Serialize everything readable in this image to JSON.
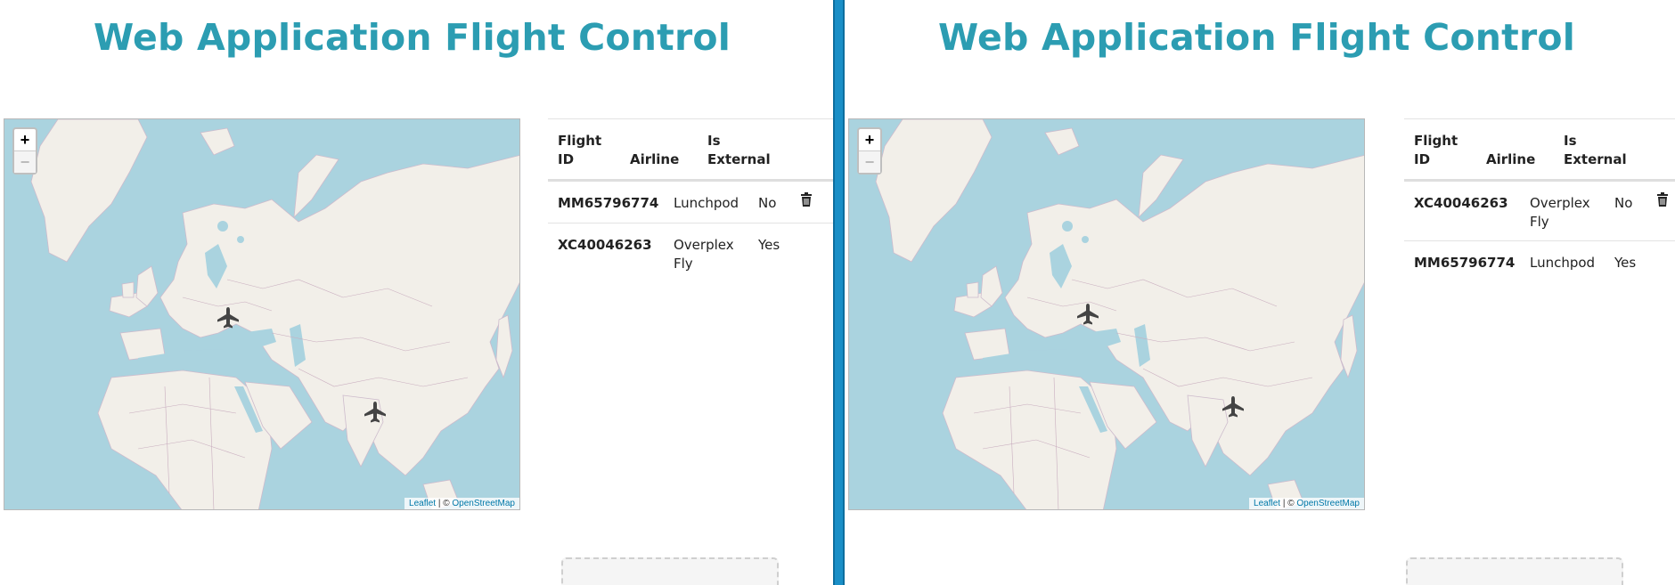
{
  "left": {
    "title": "Web Application Flight Control",
    "map": {
      "zoom_in": "+",
      "zoom_out": "−",
      "attribution": {
        "leaflet": "Leaflet",
        "sep": " | © ",
        "osm": "OpenStreetMap"
      },
      "plane_icon": "airplane-icon"
    },
    "table": {
      "headers": {
        "flight_id": "Flight ID",
        "airline": "Airline",
        "is_external": "Is External"
      },
      "rows": [
        {
          "flight_id": "MM65796774",
          "airline": "Lunchpod",
          "is_external": "No",
          "deletable": true
        },
        {
          "flight_id": "XC40046263",
          "airline": "Overplex Fly",
          "is_external": "Yes",
          "deletable": false
        }
      ]
    }
  },
  "right": {
    "title": "Web Application Flight Control",
    "map": {
      "zoom_in": "+",
      "zoom_out": "−",
      "attribution": {
        "leaflet": "Leaflet",
        "sep": " | © ",
        "osm": "OpenStreetMap"
      },
      "plane_icon": "airplane-icon"
    },
    "table": {
      "headers": {
        "flight_id": "Flight ID",
        "airline": "Airline",
        "is_external": "Is External"
      },
      "rows": [
        {
          "flight_id": "XC40046263",
          "airline": "Overplex Fly",
          "is_external": "No",
          "deletable": true
        },
        {
          "flight_id": "MM65796774",
          "airline": "Lunchpod",
          "is_external": "Yes",
          "deletable": false
        }
      ]
    }
  },
  "colors": {
    "title": "#2c9db2",
    "water": "#aad3df",
    "land": "#f2efe9",
    "divider": "#1a8fc7",
    "plane": "#444444"
  }
}
